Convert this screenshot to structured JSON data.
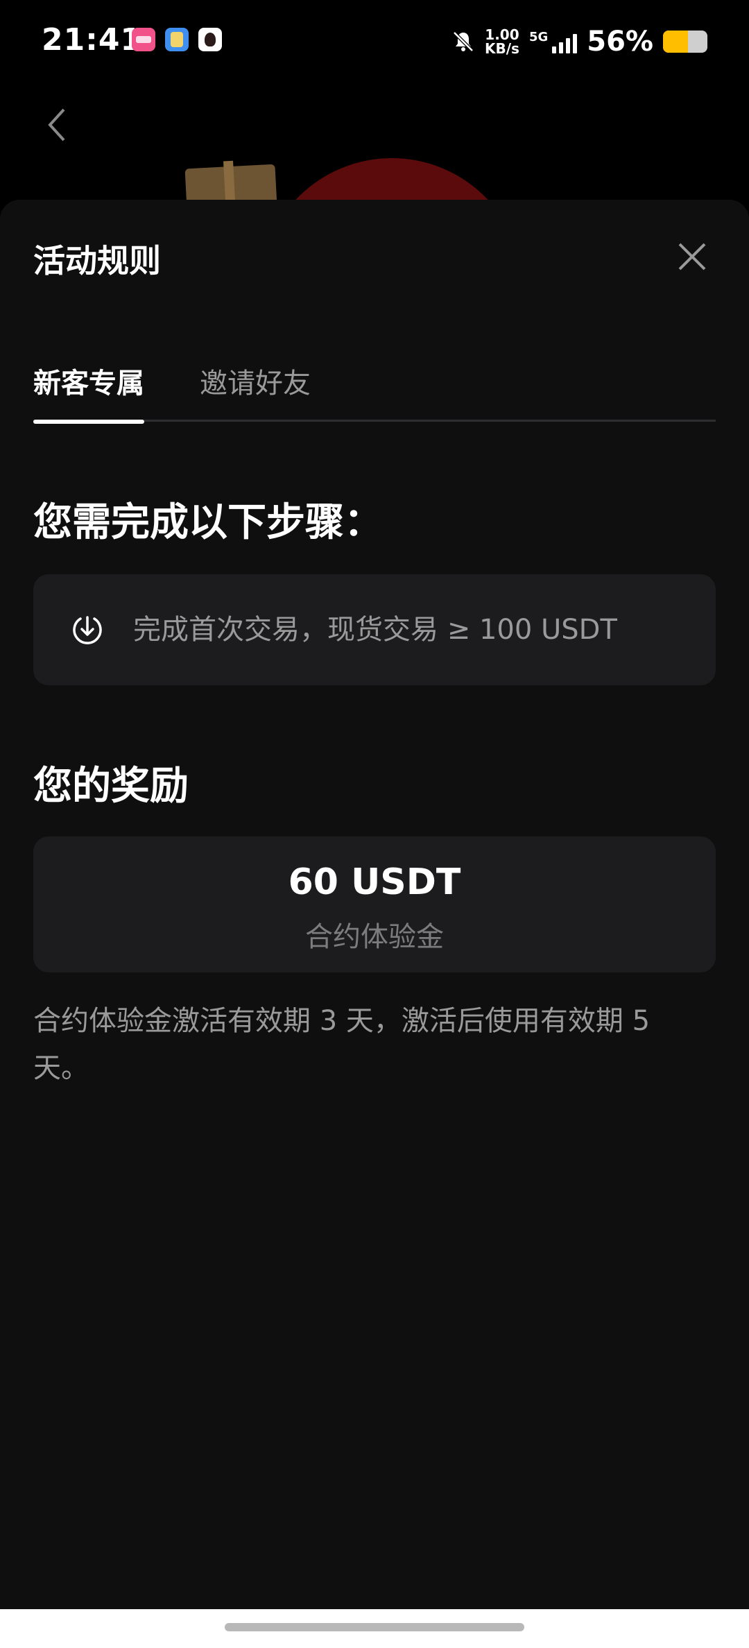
{
  "status_bar": {
    "time": "21:41",
    "network_speed_value": "1.00",
    "network_speed_unit": "KB/s",
    "network_type": "5G",
    "battery_percent_text": "56%",
    "battery_level": 0.56,
    "icons": [
      "app-icon-1",
      "app-icon-2",
      "app-icon-3",
      "bell-muted-icon",
      "signal-icon",
      "battery-icon"
    ]
  },
  "background": {
    "back_icon": "chevron-left-icon"
  },
  "sheet": {
    "title": "活动规则",
    "close_icon": "close-icon",
    "tabs": [
      {
        "label": "新客专属",
        "active": true
      },
      {
        "label": "邀请好友",
        "active": false
      }
    ],
    "steps_heading": "您需完成以下步骤：",
    "steps": [
      {
        "icon": "download-circle-icon",
        "text": "完成首次交易，现货交易 ≥ 100 USDT"
      }
    ],
    "rewards_heading": "您的奖励",
    "reward": {
      "amount": "60 USDT",
      "label": "合约体验金"
    },
    "note": "合约体验金激活有效期 3 天，激活后使用有效期 5 天。"
  },
  "colors": {
    "background": "#000000",
    "sheet": "#0f0f10",
    "card": "#1c1c1e",
    "text_primary": "#ffffff",
    "text_secondary": "#9a9a9a",
    "battery_fill": "#ffbf00"
  }
}
